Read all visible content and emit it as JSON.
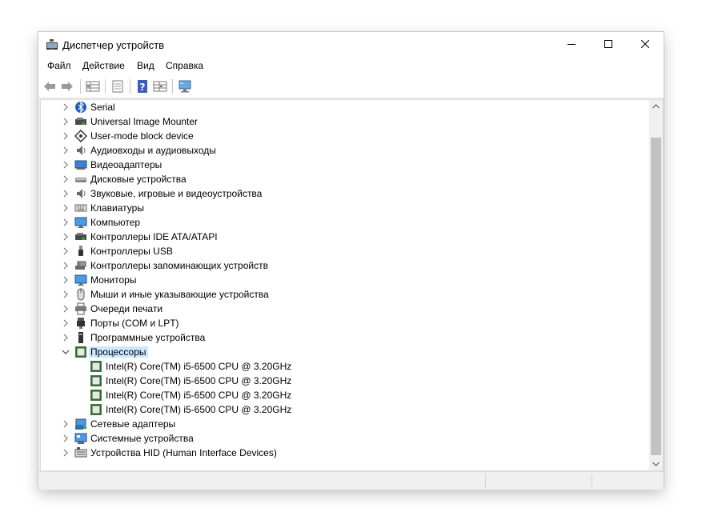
{
  "window": {
    "title": "Диспетчер устройств",
    "icon": "device-manager-icon"
  },
  "menu": [
    "Файл",
    "Действие",
    "Вид",
    "Справка"
  ],
  "toolbar": [
    "back-icon",
    "forward-icon",
    "properties-grid-icon",
    "document-icon",
    "help-icon",
    "grid-icon",
    "monitor-scan-icon"
  ],
  "tree": {
    "selected": "Процессоры",
    "categories": [
      {
        "label": "Serial",
        "icon": "bluetooth-icon",
        "expanded": false
      },
      {
        "label": "Universal Image Mounter",
        "icon": "controller-icon",
        "expanded": false
      },
      {
        "label": "User-mode block device",
        "icon": "block-device-icon",
        "expanded": false
      },
      {
        "label": "Аудиовходы и аудиовыходы",
        "icon": "speaker-icon",
        "expanded": false
      },
      {
        "label": "Видеоадаптеры",
        "icon": "display-adapter-icon",
        "expanded": false
      },
      {
        "label": "Дисковые устройства",
        "icon": "disk-icon",
        "expanded": false
      },
      {
        "label": "Звуковые, игровые и видеоустройства",
        "icon": "speaker-icon",
        "expanded": false
      },
      {
        "label": "Клавиатуры",
        "icon": "keyboard-icon",
        "expanded": false
      },
      {
        "label": "Компьютер",
        "icon": "monitor-icon",
        "expanded": false
      },
      {
        "label": "Контроллеры IDE ATA/ATAPI",
        "icon": "controller-icon",
        "expanded": false
      },
      {
        "label": "Контроллеры USB",
        "icon": "usb-icon",
        "expanded": false
      },
      {
        "label": "Контроллеры запоминающих устройств",
        "icon": "storage-controller-icon",
        "expanded": false
      },
      {
        "label": "Мониторы",
        "icon": "monitor-icon",
        "expanded": false
      },
      {
        "label": "Мыши и иные указывающие устройства",
        "icon": "mouse-icon",
        "expanded": false
      },
      {
        "label": "Очереди печати",
        "icon": "printer-icon",
        "expanded": false
      },
      {
        "label": "Порты (COM и LPT)",
        "icon": "port-icon",
        "expanded": false
      },
      {
        "label": "Программные устройства",
        "icon": "software-device-icon",
        "expanded": false
      },
      {
        "label": "Процессоры",
        "icon": "processor-icon",
        "expanded": true,
        "children": [
          "Intel(R) Core(TM) i5-6500 CPU @ 3.20GHz",
          "Intel(R) Core(TM) i5-6500 CPU @ 3.20GHz",
          "Intel(R) Core(TM) i5-6500 CPU @ 3.20GHz",
          "Intel(R) Core(TM) i5-6500 CPU @ 3.20GHz"
        ]
      },
      {
        "label": "Сетевые адаптеры",
        "icon": "network-adapter-icon",
        "expanded": false
      },
      {
        "label": "Системные устройства",
        "icon": "system-device-icon",
        "expanded": false
      },
      {
        "label": "Устройства HID (Human Interface Devices)",
        "icon": "hid-icon",
        "expanded": false
      }
    ]
  },
  "colors": {
    "selection": "#cce8ff",
    "window_bg": "#f0f0f0"
  }
}
